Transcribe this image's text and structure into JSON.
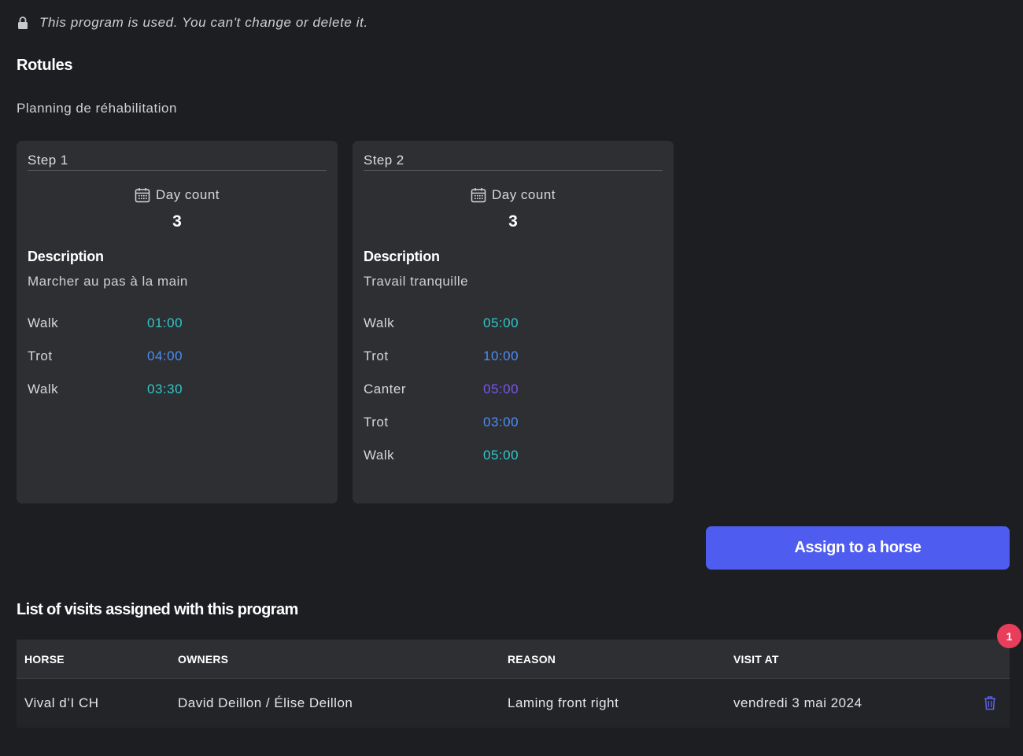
{
  "notice": {
    "icon": "lock-icon",
    "text": "This program is used. You can't change or delete it."
  },
  "program": {
    "title": "Rotules",
    "subtitle": "Planning de réhabilitation"
  },
  "steps": [
    {
      "label": "Step 1",
      "day_count_label": "Day count",
      "day_count": "3",
      "description_label": "Description",
      "description": "Marcher au pas à la main",
      "exercises": [
        {
          "name": "Walk",
          "duration": "01:00",
          "color": "#2ec8c8"
        },
        {
          "name": "Trot",
          "duration": "04:00",
          "color": "#4d8cf5"
        },
        {
          "name": "Walk",
          "duration": "03:30",
          "color": "#2ec8c8"
        }
      ]
    },
    {
      "label": "Step 2",
      "day_count_label": "Day count",
      "day_count": "3",
      "description_label": "Description",
      "description": "Travail tranquille",
      "exercises": [
        {
          "name": "Walk",
          "duration": "05:00",
          "color": "#2ec8c8"
        },
        {
          "name": "Trot",
          "duration": "10:00",
          "color": "#4d8cf5"
        },
        {
          "name": "Canter",
          "duration": "05:00",
          "color": "#7a55f0"
        },
        {
          "name": "Trot",
          "duration": "03:00",
          "color": "#4d8cf5"
        },
        {
          "name": "Walk",
          "duration": "05:00",
          "color": "#2ec8c8"
        }
      ]
    }
  ],
  "assign_button": {
    "label": "Assign to a horse",
    "color": "#4f5cf0"
  },
  "visits": {
    "title": "List of visits assigned with this program",
    "badge_count": "1",
    "columns": [
      "HORSE",
      "OWNERS",
      "REASON",
      "VISIT AT"
    ],
    "rows": [
      {
        "horse": "Vival d’I CH",
        "owners": "David Deillon / Élise Deillon",
        "reason": "Laming front right",
        "visit_at": "vendredi 3 mai 2024",
        "action_icon": "trash-icon"
      }
    ]
  }
}
